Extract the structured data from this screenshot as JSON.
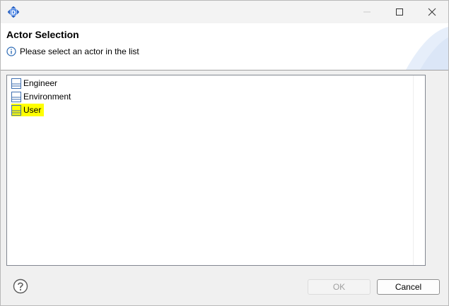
{
  "window": {
    "app_icon_letter": "D"
  },
  "banner": {
    "title": "Actor Selection",
    "message": "Please select an actor in the list"
  },
  "list": {
    "items": [
      {
        "label": "Engineer",
        "icon": "actor-icon",
        "selected": false
      },
      {
        "label": "Environment",
        "icon": "actor-icon",
        "selected": false
      },
      {
        "label": "User",
        "icon": "actor-icon",
        "selected": true
      }
    ]
  },
  "footer": {
    "ok_label": "OK",
    "cancel_label": "Cancel"
  },
  "colors": {
    "selection_highlight": "#ffff00",
    "actor_icon_blue": "#3f6fb0"
  }
}
